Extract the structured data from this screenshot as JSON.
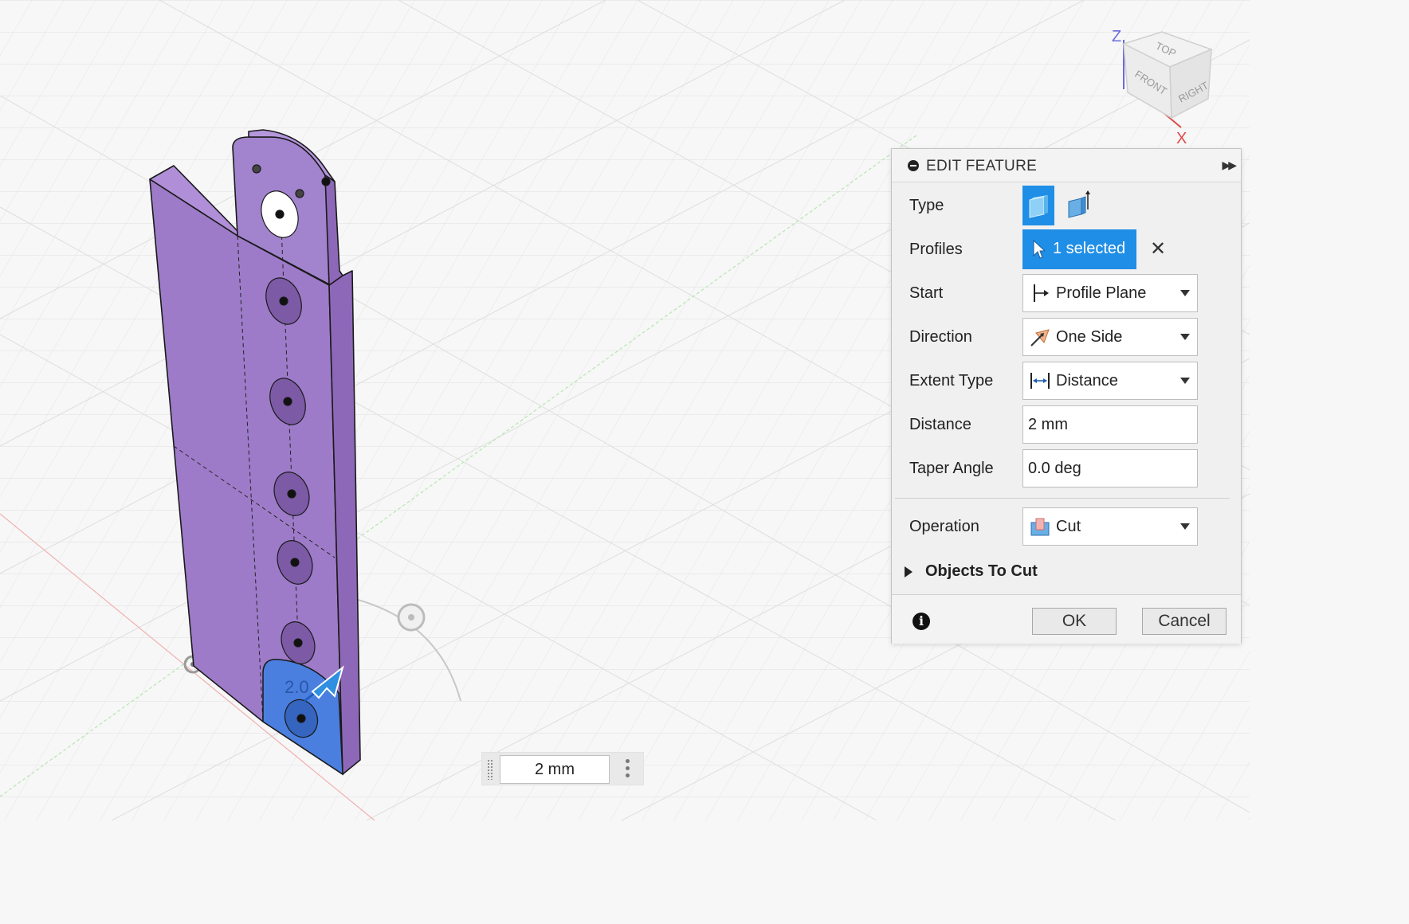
{
  "panel": {
    "title": "EDIT FEATURE",
    "rows": {
      "type_label": "Type",
      "profiles_label": "Profiles",
      "profiles_value": "1 selected",
      "start_label": "Start",
      "start_value": "Profile Plane",
      "direction_label": "Direction",
      "direction_value": "One Side",
      "extent_label": "Extent Type",
      "extent_value": "Distance",
      "distance_label": "Distance",
      "distance_value": "2 mm",
      "taper_label": "Taper Angle",
      "taper_value": "0.0 deg",
      "operation_label": "Operation",
      "operation_value": "Cut",
      "objects_label": "Objects To Cut"
    },
    "ok_label": "OK",
    "cancel_label": "Cancel",
    "accent_color": "#1f8ee6"
  },
  "viewcube": {
    "top": "TOP",
    "front": "FRONT",
    "right": "RIGHT",
    "axis_z": "Z",
    "axis_x": "X"
  },
  "canvas": {
    "distance_input": "2 mm",
    "manipulator_label": "2.0",
    "body_color": "#a47fcf",
    "selected_profile_color": "#4a7fe0"
  }
}
